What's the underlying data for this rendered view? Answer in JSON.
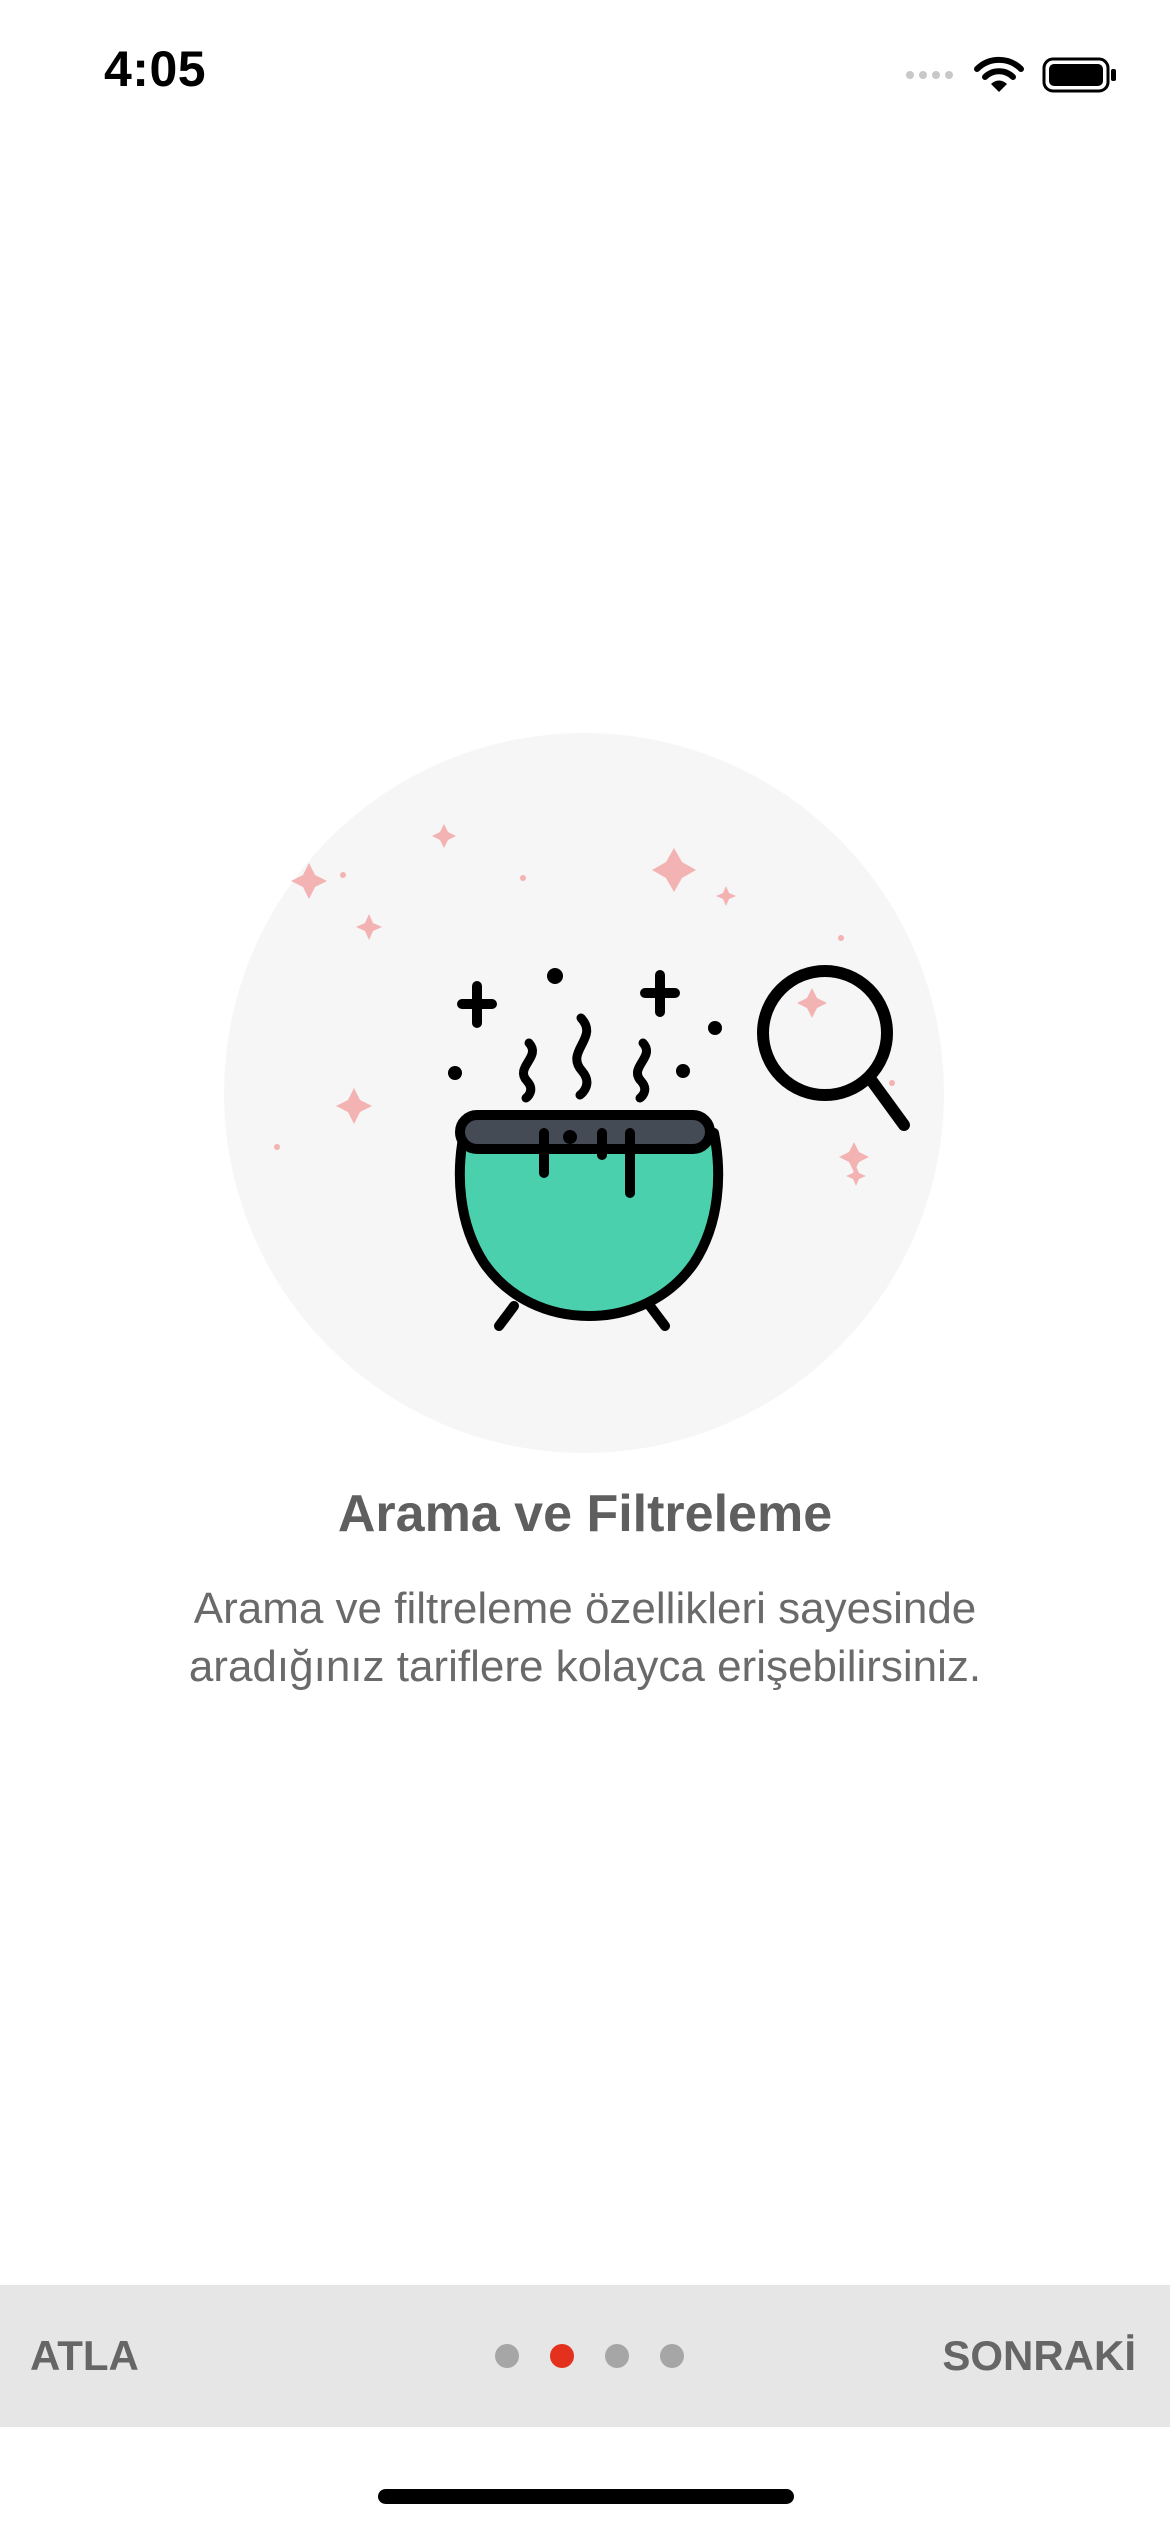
{
  "status_bar": {
    "time": "4:05",
    "signal_icon": "cellular-signal-icon",
    "wifi_icon": "wifi-icon",
    "battery_icon": "battery-icon"
  },
  "onboarding": {
    "illustration": {
      "icon": "cauldron-search-icon",
      "pot_color": "#4ad0ad",
      "sparkle_color": "#f3b3b3",
      "background_color": "#f6f6f6"
    },
    "title": "Arama ve Filtreleme",
    "description": "Arama ve filtreleme özellikleri sayesinde aradığınız tariflere kolayca erişebilirsiniz."
  },
  "bottom_bar": {
    "skip_label": "ATLA",
    "next_label": "SONRAKİ",
    "pages": [
      {
        "active": false
      },
      {
        "active": true
      },
      {
        "active": false
      },
      {
        "active": false
      }
    ],
    "active_dot_color": "#e3311d",
    "inactive_dot_color": "#a6a6a6"
  }
}
